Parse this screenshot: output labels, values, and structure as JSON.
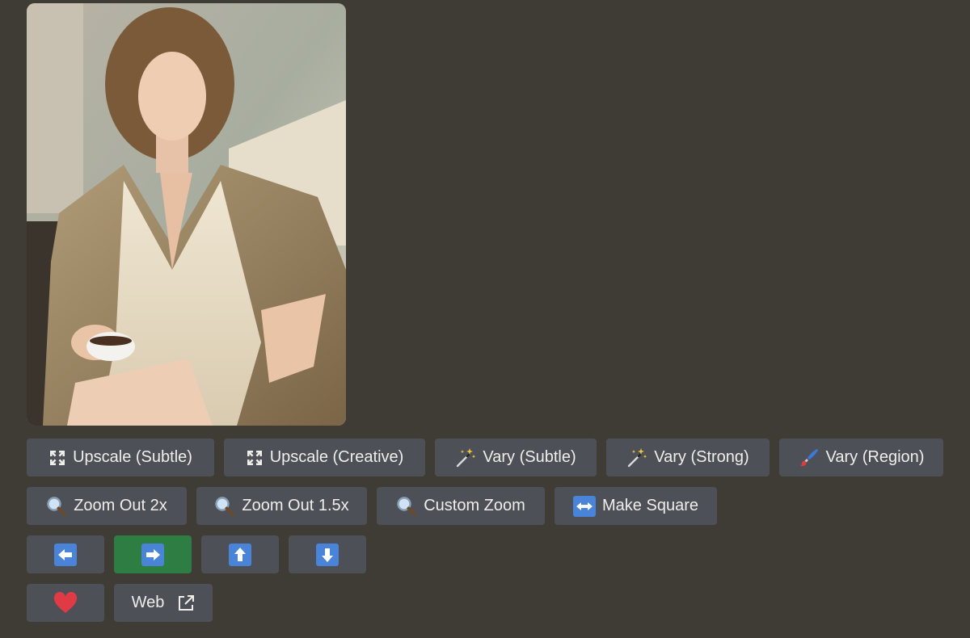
{
  "buttons": {
    "upscale_subtle": "Upscale (Subtle)",
    "upscale_creative": "Upscale (Creative)",
    "vary_subtle": "Vary (Subtle)",
    "vary_strong": "Vary (Strong)",
    "vary_region": "Vary (Region)",
    "zoom_out_2x": "Zoom Out 2x",
    "zoom_out_1_5x": "Zoom Out 1.5x",
    "custom_zoom": "Custom Zoom",
    "make_square": "Make Square",
    "web": "Web"
  },
  "pan": {
    "active": "right"
  },
  "icons": {
    "upscale": "expand-arrows-icon",
    "vary": "magic-wand-icon",
    "region": "paintbrush-icon",
    "zoom": "magnifier-icon",
    "square": "left-right-arrow-icon",
    "pan_left": "arrow-left-icon",
    "pan_right": "arrow-right-icon",
    "pan_up": "arrow-up-icon",
    "pan_down": "arrow-down-icon",
    "favorite": "heart-icon",
    "external": "external-link-icon"
  },
  "colors": {
    "background": "#3f3c36",
    "button": "#4d5057",
    "button_active": "#2e7d43",
    "arrow_tile": "#4a84d8",
    "heart": "#e03a45"
  }
}
